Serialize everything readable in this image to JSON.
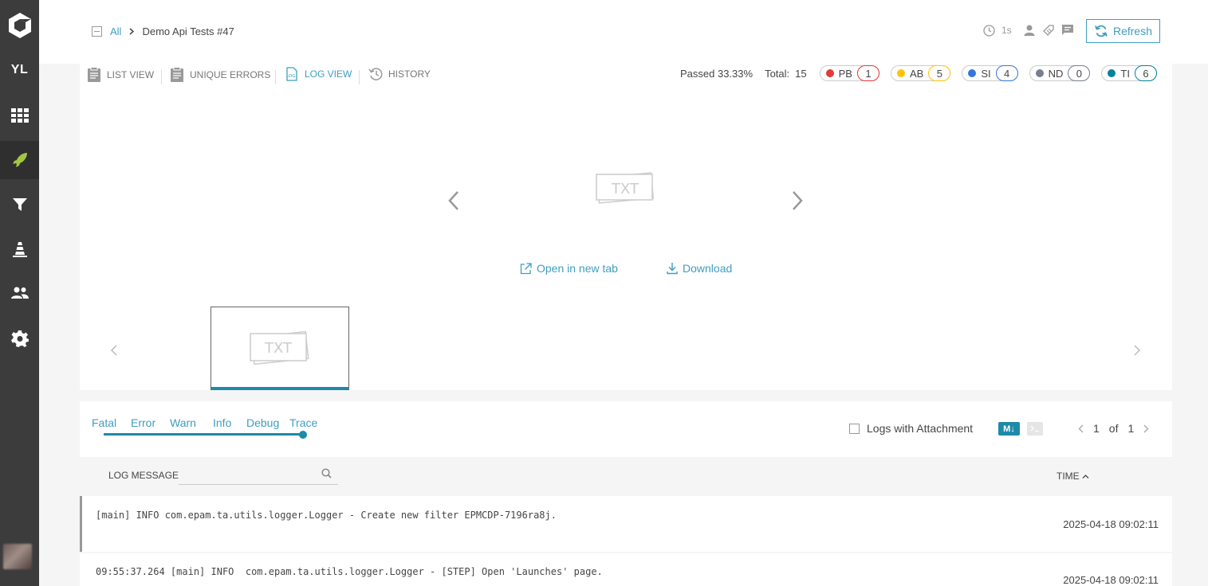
{
  "sidebar": {
    "project_initials": "YL",
    "items": [
      {
        "name": "dashboard",
        "icon": "grid-icon"
      },
      {
        "name": "launches",
        "icon": "rocket-icon"
      },
      {
        "name": "filters",
        "icon": "filter-icon"
      },
      {
        "name": "debug",
        "icon": "cone-icon"
      },
      {
        "name": "members",
        "icon": "users-icon"
      },
      {
        "name": "settings",
        "icon": "gear-icon"
      }
    ]
  },
  "breadcrumb": {
    "root": "All",
    "current": "Demo Api Tests #47"
  },
  "header": {
    "duration": "1s",
    "refresh_label": "Refresh"
  },
  "tabs": [
    {
      "label": "List view"
    },
    {
      "label": "Unique errors"
    },
    {
      "label": "Log view"
    },
    {
      "label": "History"
    }
  ],
  "stats": {
    "passed": "Passed 33.33%",
    "total_label": "Total:",
    "total_value": "15",
    "defects": [
      {
        "code": "PB",
        "count": "1",
        "color": "#e53935"
      },
      {
        "code": "AB",
        "count": "5",
        "color": "#ffc208"
      },
      {
        "code": "SI",
        "count": "4",
        "color": "#3377dd"
      },
      {
        "code": "ND",
        "count": "0",
        "color": "#777e90"
      },
      {
        "code": "TI",
        "count": "6",
        "color": "#00829b"
      }
    ]
  },
  "attachments": {
    "file_type": "TXT",
    "open_label": "Open in new tab",
    "download_label": "Download"
  },
  "log_levels": [
    "Fatal",
    "Error",
    "Warn",
    "Info",
    "Debug",
    "Trace"
  ],
  "log_controls": {
    "attachment_filter_label": "Logs with Attachment",
    "markdown_label": "M↓",
    "page_current": "1",
    "page_of": "of",
    "page_total": "1"
  },
  "log_table": {
    "message_header": "Log message",
    "time_header": "Time",
    "rows": [
      {
        "message": "[main] INFO com.epam.ta.utils.logger.Logger - Create new filter EPMCDP-7196ra8j.",
        "time": "2025-04-18 09:02:11"
      },
      {
        "message": "09:55:37.264 [main] INFO  com.epam.ta.utils.logger.Logger - [STEP] Open 'Launches' page.",
        "time": "2025-04-18 09:02:11"
      }
    ]
  },
  "colors": {
    "accent": "#3f9ec1",
    "sidebar_bg": "#3c3c3c",
    "active_launches_icon": "#a3c644"
  }
}
